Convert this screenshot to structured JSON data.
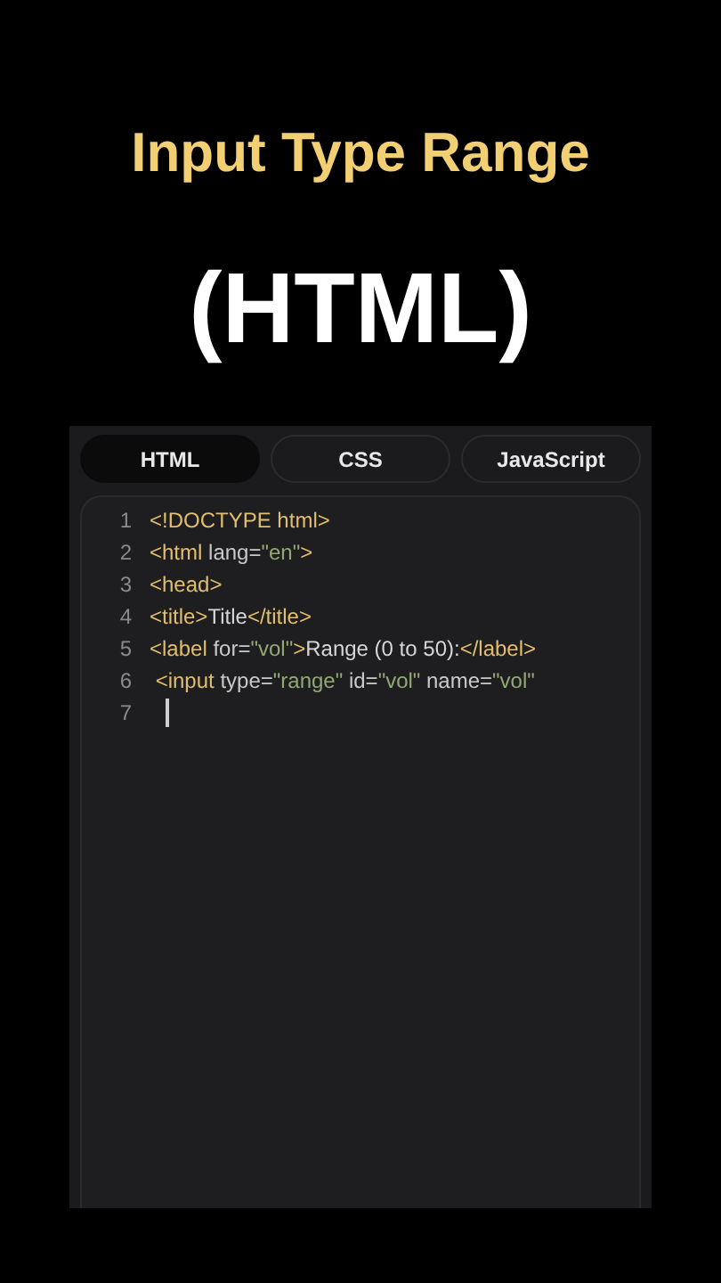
{
  "title": "Input Type Range",
  "subtitle": "(HTML)",
  "tabs": [
    {
      "label": "HTML",
      "selected": true
    },
    {
      "label": "CSS",
      "selected": false
    },
    {
      "label": "JavaScript",
      "selected": false
    }
  ],
  "code_lines": [
    {
      "number": "1",
      "cursor": false,
      "tokens": [
        {
          "kind": "tag",
          "text": "<!DOCTYPE html>"
        }
      ]
    },
    {
      "number": "2",
      "cursor": false,
      "tokens": [
        {
          "kind": "tag",
          "text": "<html"
        },
        {
          "kind": "attr",
          "text": " lang="
        },
        {
          "kind": "string",
          "text": "\"en\""
        },
        {
          "kind": "tag",
          "text": ">"
        }
      ]
    },
    {
      "number": "3",
      "cursor": false,
      "tokens": [
        {
          "kind": "tag",
          "text": "<head>"
        }
      ]
    },
    {
      "number": "4",
      "cursor": false,
      "tokens": [
        {
          "kind": "tag",
          "text": "<title>"
        },
        {
          "kind": "text",
          "text": "Title"
        },
        {
          "kind": "tag",
          "text": "</title>"
        }
      ]
    },
    {
      "number": "5",
      "cursor": false,
      "tokens": [
        {
          "kind": "tag",
          "text": "<label"
        },
        {
          "kind": "attr",
          "text": " for="
        },
        {
          "kind": "string",
          "text": "\"vol\""
        },
        {
          "kind": "tag",
          "text": ">"
        },
        {
          "kind": "text",
          "text": "Range (0 to 50):"
        },
        {
          "kind": "tag",
          "text": "</label>"
        }
      ]
    },
    {
      "number": "6",
      "cursor": false,
      "tokens": [
        {
          "kind": "tag",
          "text": " <input"
        },
        {
          "kind": "attr",
          "text": " type="
        },
        {
          "kind": "string",
          "text": "\"range\""
        },
        {
          "kind": "attr",
          "text": " id="
        },
        {
          "kind": "string",
          "text": "\"vol\""
        },
        {
          "kind": "attr",
          "text": " name="
        },
        {
          "kind": "string",
          "text": "\"vol\""
        }
      ]
    },
    {
      "number": "7",
      "cursor": true
    }
  ]
}
